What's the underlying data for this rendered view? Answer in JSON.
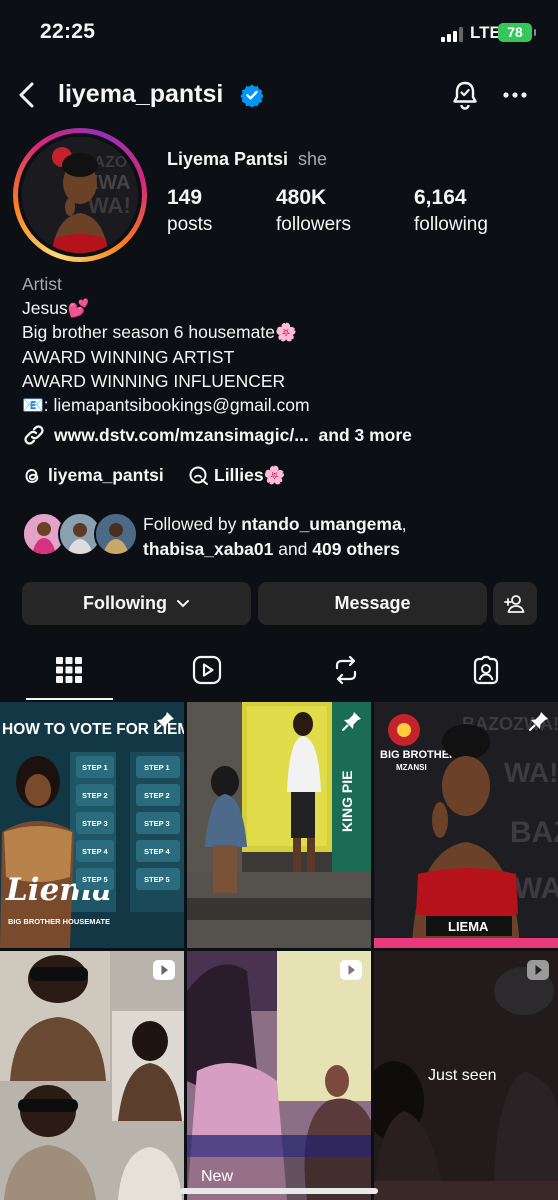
{
  "status_bar": {
    "time": "22:25",
    "network": "LTE",
    "battery": "78"
  },
  "header": {
    "username": "liyema_pantsi"
  },
  "profile": {
    "display_name": "Liyema Pantsi",
    "pronoun": "she",
    "stats": [
      {
        "value": "149",
        "label": "posts"
      },
      {
        "value": "480K",
        "label": "followers"
      },
      {
        "value": "6,164",
        "label": "following"
      }
    ],
    "category": "Artist",
    "bio_lines": [
      "Jesus💕",
      "Big brother season 6 housemate🌸",
      "AWARD WINNING ARTIST",
      "AWARD WINNING INFLUENCER",
      "📧: liemapantsibookings@gmail.com"
    ],
    "link": "www.dstv.com/mzansimagic/...",
    "link_more": "and 3 more",
    "threads_handle": "liyema_pantsi",
    "channel_name": "Lillies🌸",
    "followed_by_prefix": "Followed by ",
    "followed_by_user1": "ntando_umangema",
    "followed_by_user2": "thabisa_xaba01",
    "followed_by_and": " and ",
    "followed_by_others": "409 others"
  },
  "buttons": {
    "following": "Following",
    "message": "Message"
  },
  "tabs": [
    {
      "icon": "grid-icon",
      "active": true
    },
    {
      "icon": "reels-icon",
      "active": false
    },
    {
      "icon": "reposts-icon",
      "active": false
    },
    {
      "icon": "tagged-icon",
      "active": false
    }
  ],
  "grid_posts": [
    {
      "type": "pinned",
      "overlay_text": "HOW TO VOTE FOR LIEMA",
      "sub_text": "Liema",
      "bottom_text": "BIG BROTHER HOUSEMATE",
      "steps": [
        "STEP 1",
        "STEP 2",
        "STEP 3",
        "STEP 4",
        "STEP 5"
      ],
      "steps_right": [
        "STEP 1",
        "STEP 2",
        "STEP 3",
        "STEP 4",
        "STEP 5"
      ]
    },
    {
      "type": "pinned",
      "overlay_text": "KING PIE"
    },
    {
      "type": "pinned",
      "top_text": "BIG BROTHER",
      "sub_text": "MZANSI",
      "name_text": "LIEMA",
      "side_text": "BAZOZWA!"
    },
    {
      "type": "reel",
      "overlay_text": ""
    },
    {
      "type": "reel",
      "overlay_text": "New"
    },
    {
      "type": "reel",
      "overlay_text": "Just seen"
    }
  ],
  "colors": {
    "background": "#0c1014",
    "button": "#262626",
    "verified": "#0095f6",
    "secondary_text": "#a8a8a8"
  }
}
